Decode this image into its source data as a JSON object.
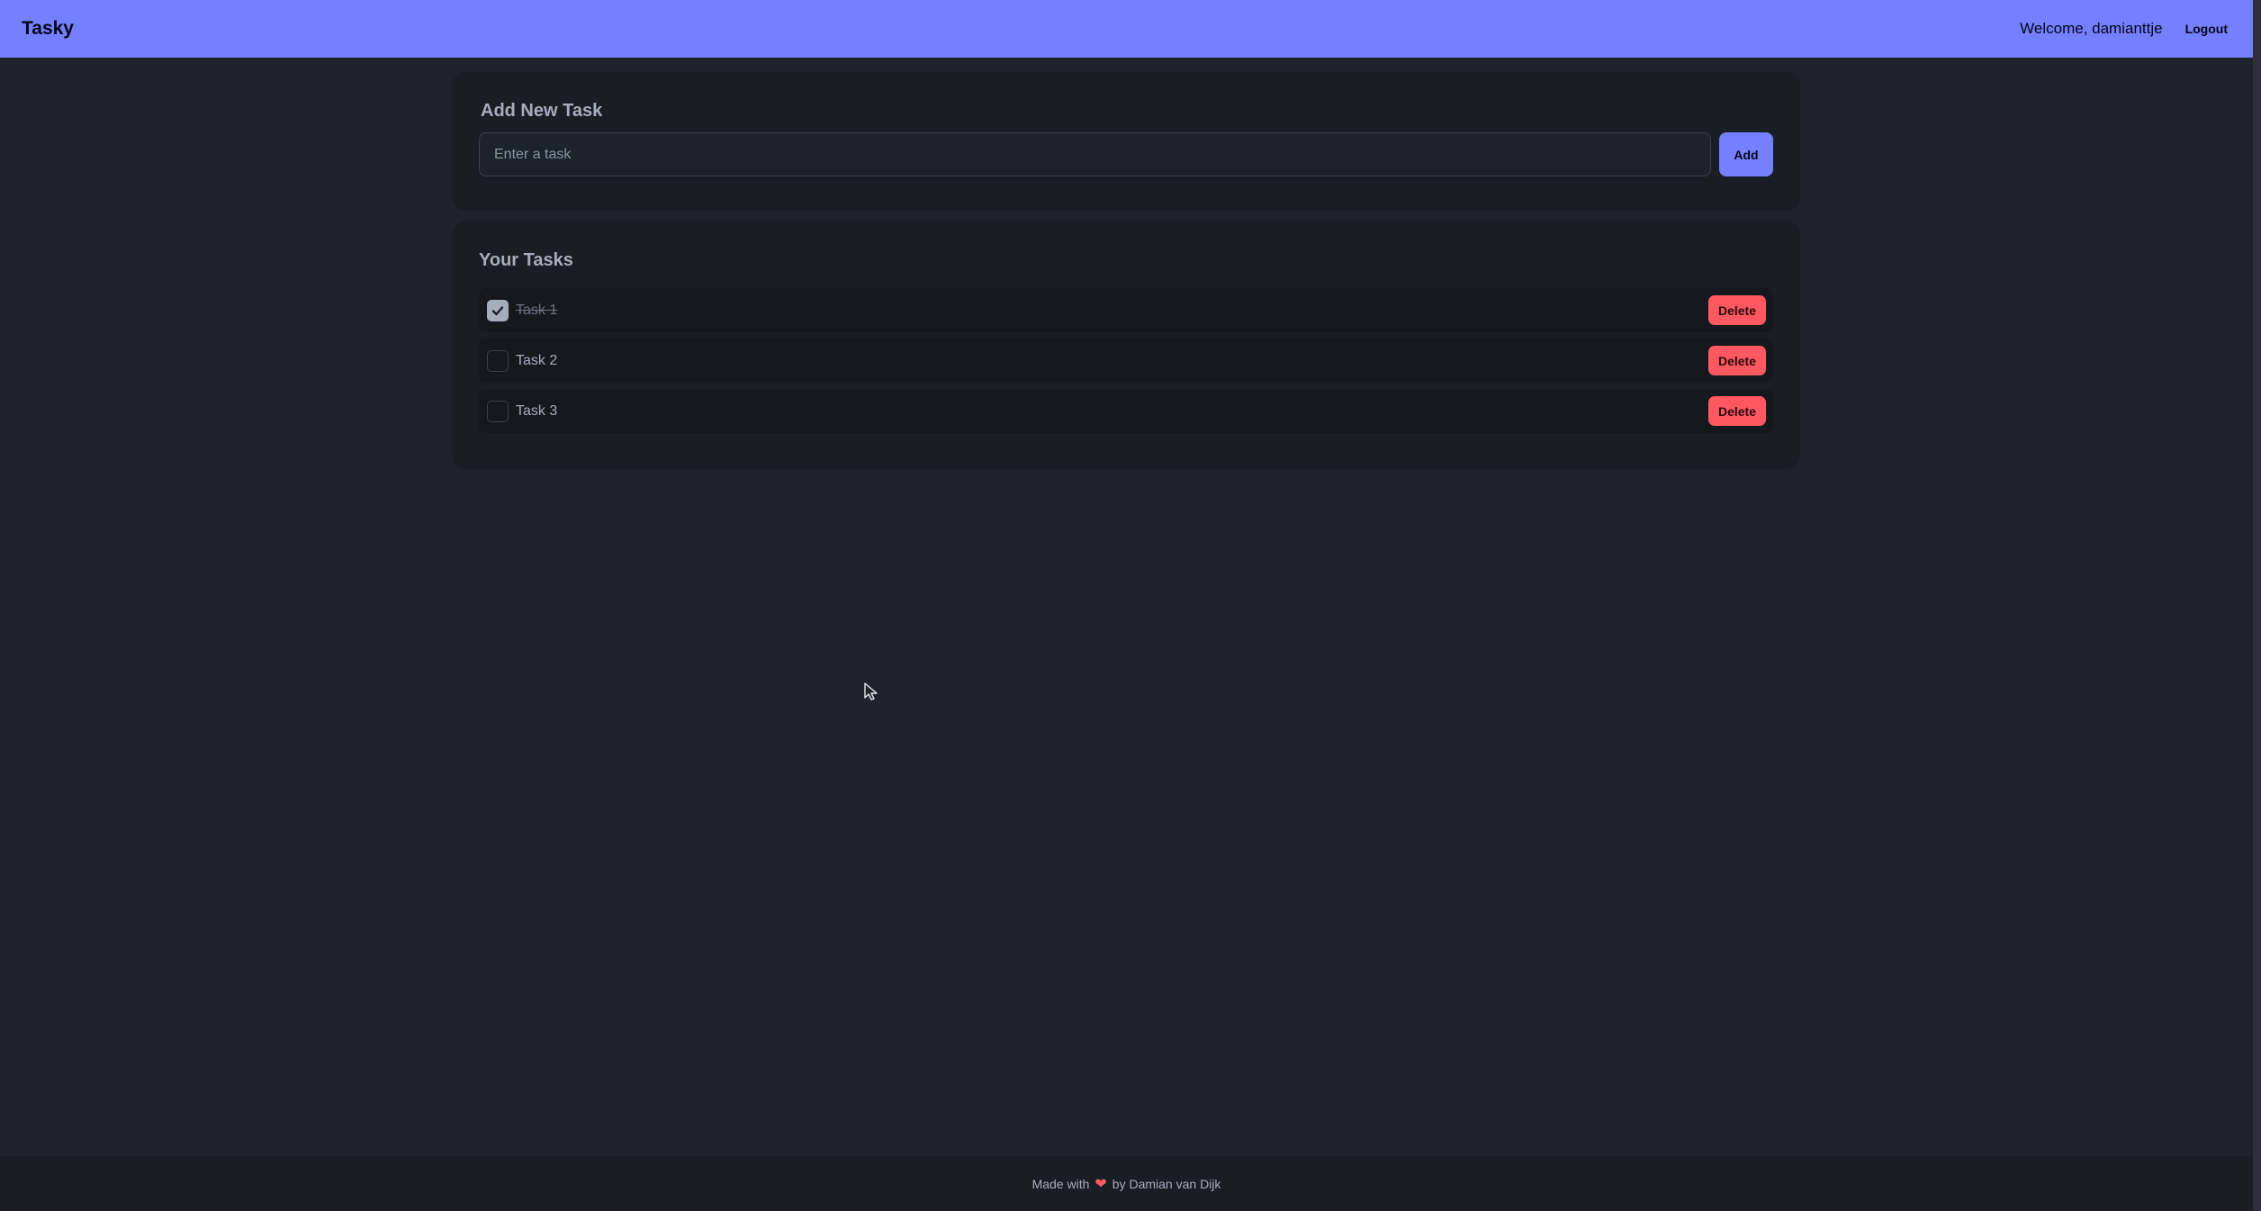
{
  "navbar": {
    "brand": "Tasky",
    "welcome": "Welcome, damianttje",
    "logout_label": "Logout",
    "bg_color": "#7480ff"
  },
  "add_task": {
    "title": "Add New Task",
    "input_placeholder": "Enter a task",
    "input_value": "",
    "add_label": "Add"
  },
  "tasks": {
    "title": "Your Tasks",
    "items": [
      {
        "label": "Task 1",
        "done": true,
        "delete_label": "Delete"
      },
      {
        "label": "Task 2",
        "done": false,
        "delete_label": "Delete"
      },
      {
        "label": "Task 3",
        "done": false,
        "delete_label": "Delete"
      }
    ]
  },
  "footer": {
    "prefix": "Made with",
    "heart_icon": "heart-icon",
    "suffix": "by Damian van Dijk"
  },
  "colors": {
    "accent": "#7480ff",
    "danger": "#ff5861",
    "background": "#1d232a",
    "card": "#191e24"
  }
}
